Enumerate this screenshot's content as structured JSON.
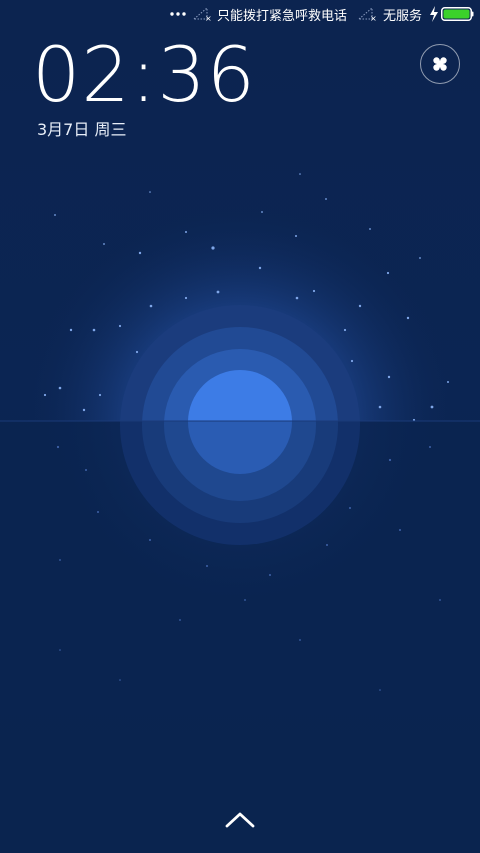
{
  "status_bar": {
    "carrier_1": "只能拨打紧急呼救电话",
    "carrier_2": "无服务",
    "icons": [
      "more-dots-icon",
      "signal-no-service-icon",
      "signal-no-service-icon",
      "charging-bolt-icon",
      "battery-icon"
    ],
    "battery_level": 1.0,
    "battery_color": "#3bd12a"
  },
  "lockscreen": {
    "time": "02:36",
    "date": "3月7日 周三",
    "apps_button_icon": "four-petal-icon",
    "unlock_icon": "chevron-up-icon"
  },
  "colors": {
    "background": "#0c2450",
    "glow": "#3a6fd6",
    "sun": "#3d7ce6",
    "text": "#ffffff"
  }
}
